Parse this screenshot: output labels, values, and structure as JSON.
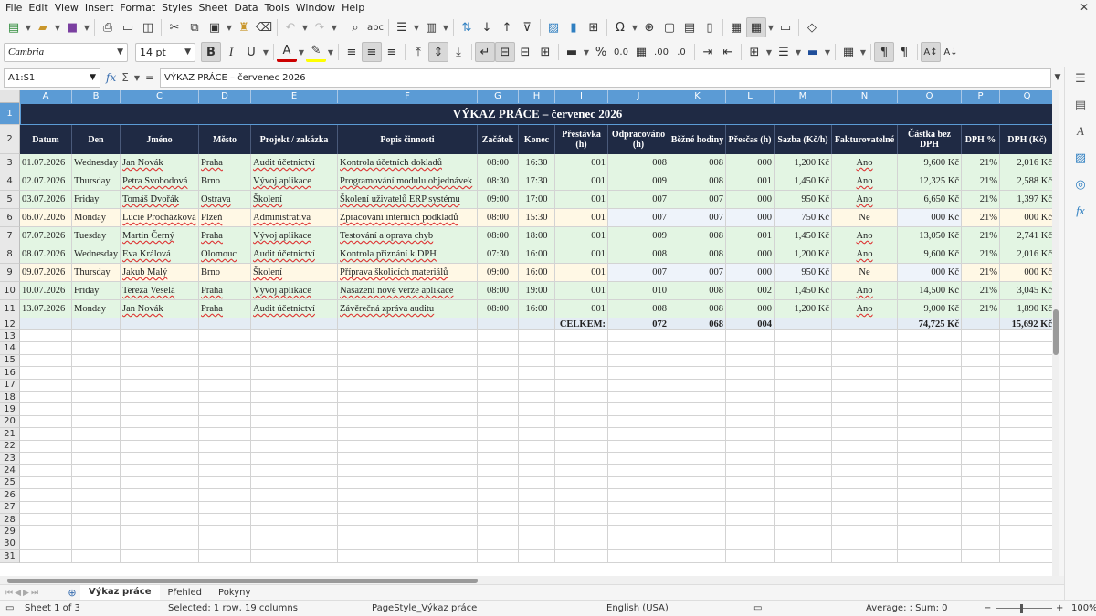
{
  "menu": [
    "File",
    "Edit",
    "View",
    "Insert",
    "Format",
    "Styles",
    "Sheet",
    "Data",
    "Tools",
    "Window",
    "Help"
  ],
  "toolbar": {
    "font_name": "Cambria",
    "font_size": "14 pt"
  },
  "formula": {
    "cell_ref": "A1:S1",
    "content": "VÝKAZ PRÁCE – červenec 2026"
  },
  "columns": [
    "A",
    "B",
    "C",
    "D",
    "E",
    "F",
    "G",
    "H",
    "I",
    "J",
    "K",
    "L",
    "M",
    "N",
    "O",
    "P",
    "Q"
  ],
  "row_numbers": [
    "1",
    "2",
    "3",
    "4",
    "5",
    "6",
    "7",
    "8",
    "9",
    "10",
    "11",
    "12",
    "13",
    "14",
    "15",
    "16",
    "17",
    "18",
    "19",
    "20",
    "21",
    "22",
    "23",
    "24",
    "25",
    "26",
    "27",
    "28",
    "29",
    "30",
    "31"
  ],
  "sheet": {
    "title": "VÝKAZ PRÁCE – červenec 2026",
    "headers": [
      "Datum",
      "Den",
      "Jméno",
      "Město",
      "Projekt / zakázka",
      "Popis činnosti",
      "Začátek",
      "Konec",
      "Přestávka (h)",
      "Odpracováno (h)",
      "Běžné hodiny",
      "Přesčas (h)",
      "Sazba (Kč/h)",
      "Fakturovatelné",
      "Částka bez DPH",
      "DPH %",
      "DPH (Kč)"
    ],
    "rows": [
      [
        "01.07.2026",
        "Wednesday",
        "Jan Novák",
        "Praha",
        "Audit účetnictví",
        "Kontrola účetních dokladů",
        "08:00",
        "16:30",
        "001",
        "008",
        "008",
        "000",
        "1,200 Kč",
        "Ano",
        "9,600 Kč",
        "21%",
        "2,016 Kč"
      ],
      [
        "02.07.2026",
        "Thursday",
        "Petra Svobodová",
        "Brno",
        "Vývoj aplikace",
        "Programování modulu objednávek",
        "08:30",
        "17:30",
        "001",
        "009",
        "008",
        "001",
        "1,450 Kč",
        "Ano",
        "12,325 Kč",
        "21%",
        "2,588 Kč"
      ],
      [
        "03.07.2026",
        "Friday",
        "Tomáš Dvořák",
        "Ostrava",
        "Školení",
        "Školení uživatelů ERP systému",
        "09:00",
        "17:00",
        "001",
        "007",
        "007",
        "000",
        "950 Kč",
        "Ano",
        "6,650 Kč",
        "21%",
        "1,397 Kč"
      ],
      [
        "06.07.2026",
        "Monday",
        "Lucie Procházková",
        "Plzeň",
        "Administrativa",
        "Zpracování interních podkladů",
        "08:00",
        "15:30",
        "001",
        "007",
        "007",
        "000",
        "750 Kč",
        "Ne",
        "000 Kč",
        "21%",
        "000 Kč"
      ],
      [
        "07.07.2026",
        "Tuesday",
        "Martin Černý",
        "Praha",
        "Vývoj aplikace",
        "Testování a oprava chyb",
        "08:00",
        "18:00",
        "001",
        "009",
        "008",
        "001",
        "1,450 Kč",
        "Ano",
        "13,050 Kč",
        "21%",
        "2,741 Kč"
      ],
      [
        "08.07.2026",
        "Wednesday",
        "Eva Králová",
        "Olomouc",
        "Audit účetnictví",
        "Kontrola přiznání k DPH",
        "07:30",
        "16:00",
        "001",
        "008",
        "008",
        "000",
        "1,200 Kč",
        "Ano",
        "9,600 Kč",
        "21%",
        "2,016 Kč"
      ],
      [
        "09.07.2026",
        "Thursday",
        "Jakub Malý",
        "Brno",
        "Školení",
        "Příprava školicích materiálů",
        "09:00",
        "16:00",
        "001",
        "007",
        "007",
        "000",
        "950 Kč",
        "Ne",
        "000 Kč",
        "21%",
        "000 Kč"
      ],
      [
        "10.07.2026",
        "Friday",
        "Tereza Veselá",
        "Praha",
        "Vývoj aplikace",
        "Nasazení nové verze aplikace",
        "08:00",
        "19:00",
        "001",
        "010",
        "008",
        "002",
        "1,450 Kč",
        "Ano",
        "14,500 Kč",
        "21%",
        "3,045 Kč"
      ],
      [
        "13.07.2026",
        "Monday",
        "Jan Novák",
        "Praha",
        "Audit účetnictví",
        "Závěrečná zpráva auditu",
        "08:00",
        "16:00",
        "001",
        "008",
        "008",
        "000",
        "1,200 Kč",
        "Ano",
        "9,000 Kč",
        "21%",
        "1,890 Kč"
      ]
    ],
    "totals": {
      "label": "CELKEM:",
      "worked": "072",
      "regular": "068",
      "overtime": "004",
      "amount": "74,725 Kč",
      "vat": "15,692 Kč"
    }
  },
  "tabs": [
    "Výkaz práce",
    "Přehled",
    "Pokyny"
  ],
  "status": {
    "sheet": "Sheet 1 of 3",
    "selection": "Selected: 1 row, 19 columns",
    "pagestyle": "PageStyle_Výkaz práce",
    "language": "English (USA)",
    "sum": "Average: ; Sum: 0",
    "zoom": "100%"
  },
  "colors": {
    "accent": "#5b9bd5",
    "header": "#1f2a44",
    "billable": "#e3f5e3",
    "nonbillable": "#fff8e5",
    "total": "#e4ecf4"
  }
}
